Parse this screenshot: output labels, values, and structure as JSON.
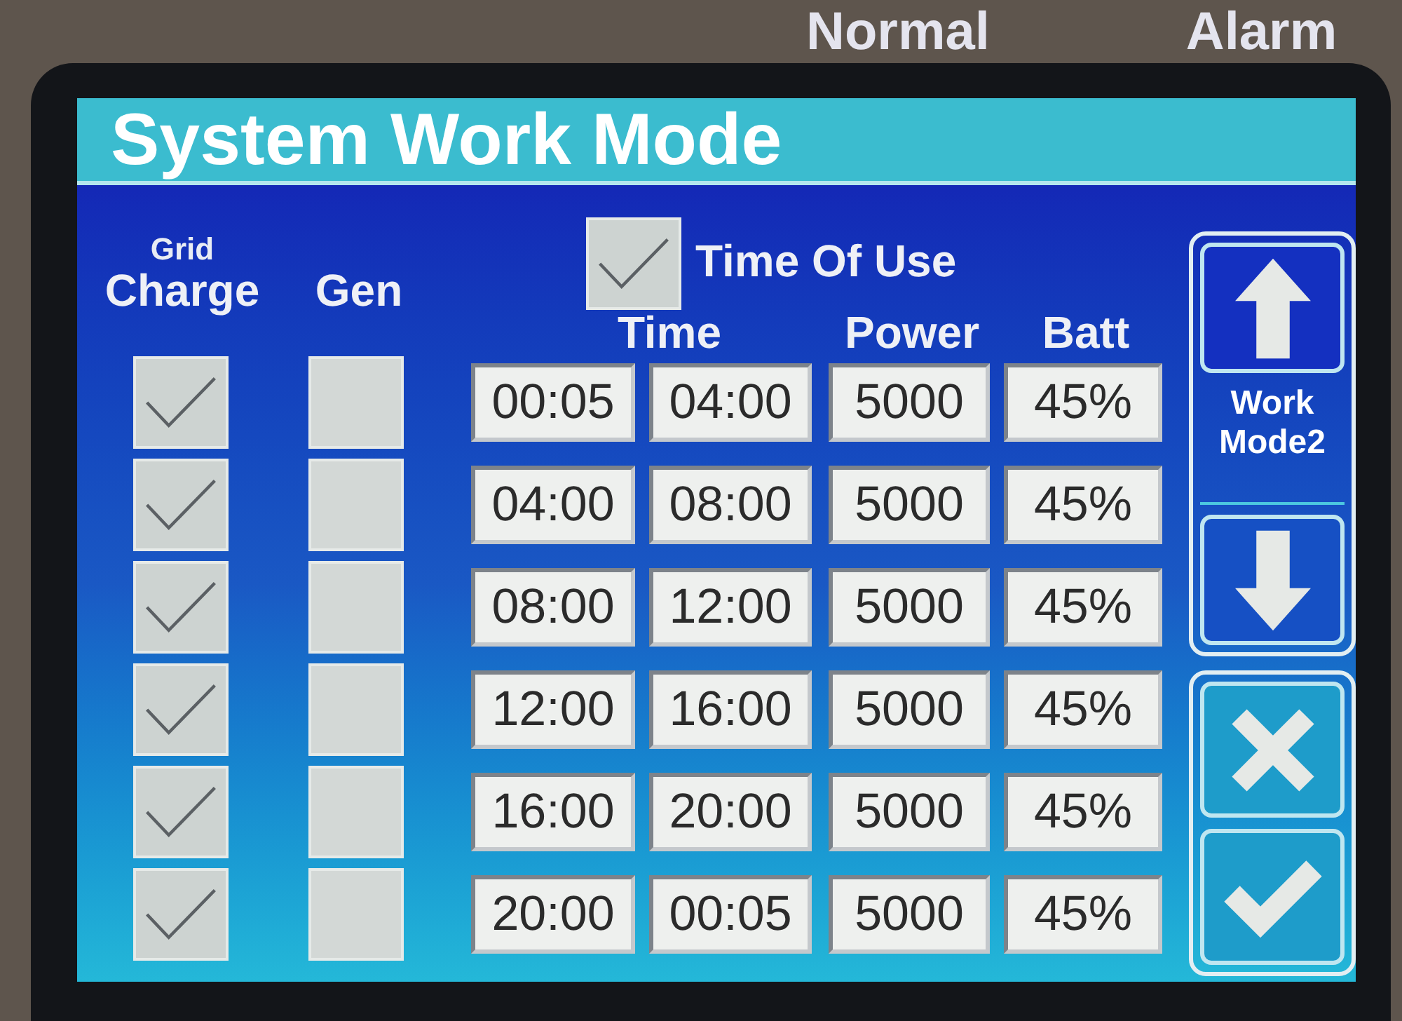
{
  "top_strip": {
    "labels": [
      "Normal",
      "Alarm"
    ]
  },
  "title": "System Work Mode",
  "column_headers": {
    "grid_charge_small": "Grid",
    "grid_charge": "Charge",
    "gen": "Gen",
    "time": "Time",
    "power": "Power",
    "batt": "Batt"
  },
  "time_of_use": {
    "label": "Time Of Use",
    "checked": true
  },
  "rows": [
    {
      "grid_charge_checked": true,
      "gen_checked": false,
      "start": "00:05",
      "end": "04:00",
      "power": "5000",
      "batt": "45%"
    },
    {
      "grid_charge_checked": true,
      "gen_checked": false,
      "start": "04:00",
      "end": "08:00",
      "power": "5000",
      "batt": "45%"
    },
    {
      "grid_charge_checked": true,
      "gen_checked": false,
      "start": "08:00",
      "end": "12:00",
      "power": "5000",
      "batt": "45%"
    },
    {
      "grid_charge_checked": true,
      "gen_checked": false,
      "start": "12:00",
      "end": "16:00",
      "power": "5000",
      "batt": "45%"
    },
    {
      "grid_charge_checked": true,
      "gen_checked": false,
      "start": "16:00",
      "end": "20:00",
      "power": "5000",
      "batt": "45%"
    },
    {
      "grid_charge_checked": true,
      "gen_checked": false,
      "start": "20:00",
      "end": "00:05",
      "power": "5000",
      "batt": "45%"
    }
  ],
  "mode_selector": {
    "label": "Work Mode2",
    "buttons": [
      {
        "kind": "up"
      },
      {
        "kind": "down"
      }
    ]
  },
  "action_buttons": [
    {
      "kind": "cancel"
    },
    {
      "kind": "confirm"
    }
  ]
}
